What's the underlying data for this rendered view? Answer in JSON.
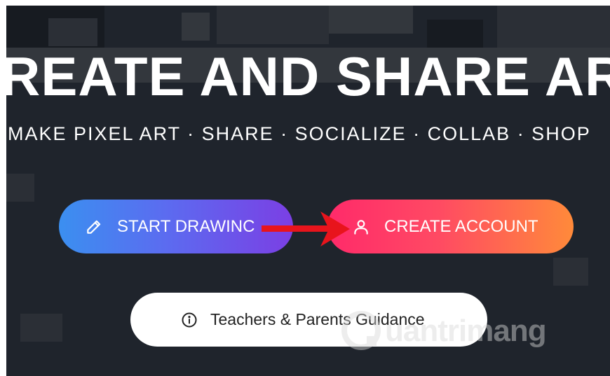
{
  "hero": {
    "title": "REATE AND SHARE AR",
    "subtitle": "MAKE PIXEL ART · SHARE · SOCIALIZE · COLLAB · SHOP"
  },
  "buttons": {
    "start_drawing": {
      "label": "START DRAWINC",
      "icon": "pencil-icon"
    },
    "create_account": {
      "label": "CREATE ACCOUNT",
      "icon": "user-icon"
    },
    "guidance": {
      "label": "Teachers & Parents Guidance",
      "icon": "info-icon"
    }
  },
  "watermark": {
    "text": "uantrimang"
  },
  "colors": {
    "background": "#1f242c",
    "start_gradient": [
      "#3b8ff0",
      "#7b3fe4"
    ],
    "create_gradient": [
      "#ff2a6a",
      "#ff8a3a"
    ],
    "arrow": "#e8141c"
  }
}
